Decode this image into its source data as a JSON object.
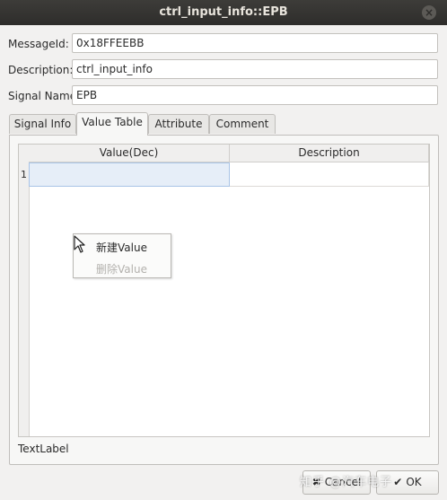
{
  "window": {
    "title": "ctrl_input_info::EPB"
  },
  "fields": {
    "message_id": {
      "label": "MessageId:",
      "value": "0x18FFEEBB"
    },
    "description": {
      "label": "Description:",
      "value": "ctrl_input_info"
    },
    "signal_name": {
      "label": "Signal Name:",
      "value": "EPB"
    }
  },
  "tabs": [
    {
      "label": "Signal Info"
    },
    {
      "label": "Value Table",
      "active": true
    },
    {
      "label": "Attribute"
    },
    {
      "label": "Comment"
    }
  ],
  "table": {
    "columns": [
      "Value(Dec)",
      "Description"
    ],
    "rows": [
      {
        "num": "1",
        "value": "",
        "description": ""
      }
    ]
  },
  "context_menu": {
    "items": [
      {
        "label": "新建Value",
        "enabled": true
      },
      {
        "label": "删除Value",
        "enabled": false
      }
    ]
  },
  "text_label": "TextLabel",
  "buttons": {
    "cancel": "Cancel",
    "ok": "OK"
  },
  "watermark": "知乎 @汽车电子"
}
